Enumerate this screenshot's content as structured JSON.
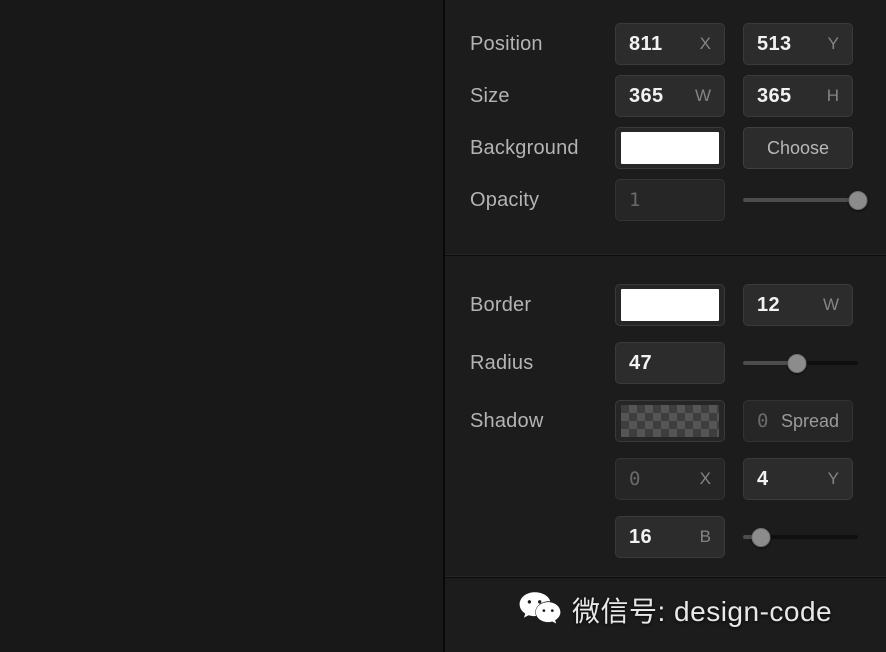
{
  "panel": {
    "sections": [
      {
        "id": "layout",
        "rows": [
          {
            "label": "Position",
            "fields": [
              {
                "kind": "number",
                "value": "811",
                "unit": "X",
                "dim": false
              },
              {
                "kind": "number",
                "value": "513",
                "unit": "Y",
                "dim": false
              }
            ]
          },
          {
            "label": "Size",
            "fields": [
              {
                "kind": "number",
                "value": "365",
                "unit": "W",
                "dim": false
              },
              {
                "kind": "number",
                "value": "365",
                "unit": "H",
                "dim": false
              }
            ]
          },
          {
            "label": "Background",
            "fields": [
              {
                "kind": "swatch",
                "color": "#ffffff"
              },
              {
                "kind": "button",
                "label": "Choose"
              }
            ]
          },
          {
            "label": "Opacity",
            "fields": [
              {
                "kind": "number",
                "value": "1",
                "unit": "",
                "dim": true
              },
              {
                "kind": "slider",
                "percent": 100
              }
            ]
          }
        ]
      },
      {
        "id": "style",
        "rows": [
          {
            "label": "Border",
            "fields": [
              {
                "kind": "swatch",
                "color": "#ffffff"
              },
              {
                "kind": "number",
                "value": "12",
                "unit": "W",
                "dim": false
              }
            ]
          },
          {
            "label": "Radius",
            "fields": [
              {
                "kind": "number",
                "value": "47",
                "unit": "",
                "dim": false
              },
              {
                "kind": "slider",
                "percent": 47
              }
            ]
          },
          {
            "label": "Shadow",
            "fields": [
              {
                "kind": "checker"
              },
              {
                "kind": "number",
                "value": "0",
                "unit": "Spread",
                "dim": true,
                "wideUnit": true
              }
            ]
          },
          {
            "label": "",
            "indent": true,
            "fields": [
              {
                "kind": "number",
                "value": "0",
                "unit": "X",
                "dim": true
              },
              {
                "kind": "number",
                "value": "4",
                "unit": "Y",
                "dim": false
              }
            ]
          },
          {
            "label": "",
            "indent": true,
            "fields": [
              {
                "kind": "number",
                "value": "16",
                "unit": "B",
                "dim": false
              },
              {
                "kind": "slider",
                "percent": 16
              }
            ]
          }
        ]
      }
    ]
  },
  "watermark": {
    "icon": "wechat-icon",
    "text": "微信号: design-code"
  },
  "colors": {
    "canvas_bg": "#181818",
    "panel_bg": "#1c1c1c",
    "field_bg": "#2c2c2c",
    "field_border": "#3a3a3a",
    "label_text": "#b4b4b4",
    "value_text": "#f2f2f2",
    "dim_text": "#6a6a6a",
    "unit_text": "#848484",
    "divider": "#0b0b0b",
    "slider_thumb": "#8c8c8c",
    "slider_fill": "#4d4d4d"
  }
}
